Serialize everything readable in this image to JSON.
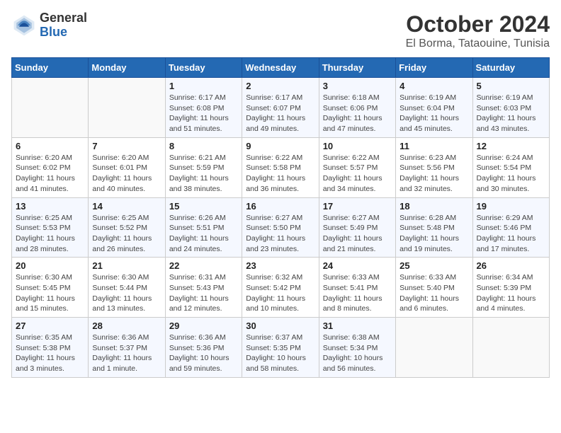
{
  "logo": {
    "general": "General",
    "blue": "Blue"
  },
  "title": "October 2024",
  "subtitle": "El Borma, Tataouine, Tunisia",
  "days_of_week": [
    "Sunday",
    "Monday",
    "Tuesday",
    "Wednesday",
    "Thursday",
    "Friday",
    "Saturday"
  ],
  "weeks": [
    [
      {
        "day": "",
        "info": ""
      },
      {
        "day": "",
        "info": ""
      },
      {
        "day": "1",
        "info": "Sunrise: 6:17 AM\nSunset: 6:08 PM\nDaylight: 11 hours and 51 minutes."
      },
      {
        "day": "2",
        "info": "Sunrise: 6:17 AM\nSunset: 6:07 PM\nDaylight: 11 hours and 49 minutes."
      },
      {
        "day": "3",
        "info": "Sunrise: 6:18 AM\nSunset: 6:06 PM\nDaylight: 11 hours and 47 minutes."
      },
      {
        "day": "4",
        "info": "Sunrise: 6:19 AM\nSunset: 6:04 PM\nDaylight: 11 hours and 45 minutes."
      },
      {
        "day": "5",
        "info": "Sunrise: 6:19 AM\nSunset: 6:03 PM\nDaylight: 11 hours and 43 minutes."
      }
    ],
    [
      {
        "day": "6",
        "info": "Sunrise: 6:20 AM\nSunset: 6:02 PM\nDaylight: 11 hours and 41 minutes."
      },
      {
        "day": "7",
        "info": "Sunrise: 6:20 AM\nSunset: 6:01 PM\nDaylight: 11 hours and 40 minutes."
      },
      {
        "day": "8",
        "info": "Sunrise: 6:21 AM\nSunset: 5:59 PM\nDaylight: 11 hours and 38 minutes."
      },
      {
        "day": "9",
        "info": "Sunrise: 6:22 AM\nSunset: 5:58 PM\nDaylight: 11 hours and 36 minutes."
      },
      {
        "day": "10",
        "info": "Sunrise: 6:22 AM\nSunset: 5:57 PM\nDaylight: 11 hours and 34 minutes."
      },
      {
        "day": "11",
        "info": "Sunrise: 6:23 AM\nSunset: 5:56 PM\nDaylight: 11 hours and 32 minutes."
      },
      {
        "day": "12",
        "info": "Sunrise: 6:24 AM\nSunset: 5:54 PM\nDaylight: 11 hours and 30 minutes."
      }
    ],
    [
      {
        "day": "13",
        "info": "Sunrise: 6:25 AM\nSunset: 5:53 PM\nDaylight: 11 hours and 28 minutes."
      },
      {
        "day": "14",
        "info": "Sunrise: 6:25 AM\nSunset: 5:52 PM\nDaylight: 11 hours and 26 minutes."
      },
      {
        "day": "15",
        "info": "Sunrise: 6:26 AM\nSunset: 5:51 PM\nDaylight: 11 hours and 24 minutes."
      },
      {
        "day": "16",
        "info": "Sunrise: 6:27 AM\nSunset: 5:50 PM\nDaylight: 11 hours and 23 minutes."
      },
      {
        "day": "17",
        "info": "Sunrise: 6:27 AM\nSunset: 5:49 PM\nDaylight: 11 hours and 21 minutes."
      },
      {
        "day": "18",
        "info": "Sunrise: 6:28 AM\nSunset: 5:48 PM\nDaylight: 11 hours and 19 minutes."
      },
      {
        "day": "19",
        "info": "Sunrise: 6:29 AM\nSunset: 5:46 PM\nDaylight: 11 hours and 17 minutes."
      }
    ],
    [
      {
        "day": "20",
        "info": "Sunrise: 6:30 AM\nSunset: 5:45 PM\nDaylight: 11 hours and 15 minutes."
      },
      {
        "day": "21",
        "info": "Sunrise: 6:30 AM\nSunset: 5:44 PM\nDaylight: 11 hours and 13 minutes."
      },
      {
        "day": "22",
        "info": "Sunrise: 6:31 AM\nSunset: 5:43 PM\nDaylight: 11 hours and 12 minutes."
      },
      {
        "day": "23",
        "info": "Sunrise: 6:32 AM\nSunset: 5:42 PM\nDaylight: 11 hours and 10 minutes."
      },
      {
        "day": "24",
        "info": "Sunrise: 6:33 AM\nSunset: 5:41 PM\nDaylight: 11 hours and 8 minutes."
      },
      {
        "day": "25",
        "info": "Sunrise: 6:33 AM\nSunset: 5:40 PM\nDaylight: 11 hours and 6 minutes."
      },
      {
        "day": "26",
        "info": "Sunrise: 6:34 AM\nSunset: 5:39 PM\nDaylight: 11 hours and 4 minutes."
      }
    ],
    [
      {
        "day": "27",
        "info": "Sunrise: 6:35 AM\nSunset: 5:38 PM\nDaylight: 11 hours and 3 minutes."
      },
      {
        "day": "28",
        "info": "Sunrise: 6:36 AM\nSunset: 5:37 PM\nDaylight: 11 hours and 1 minute."
      },
      {
        "day": "29",
        "info": "Sunrise: 6:36 AM\nSunset: 5:36 PM\nDaylight: 10 hours and 59 minutes."
      },
      {
        "day": "30",
        "info": "Sunrise: 6:37 AM\nSunset: 5:35 PM\nDaylight: 10 hours and 58 minutes."
      },
      {
        "day": "31",
        "info": "Sunrise: 6:38 AM\nSunset: 5:34 PM\nDaylight: 10 hours and 56 minutes."
      },
      {
        "day": "",
        "info": ""
      },
      {
        "day": "",
        "info": ""
      }
    ]
  ]
}
